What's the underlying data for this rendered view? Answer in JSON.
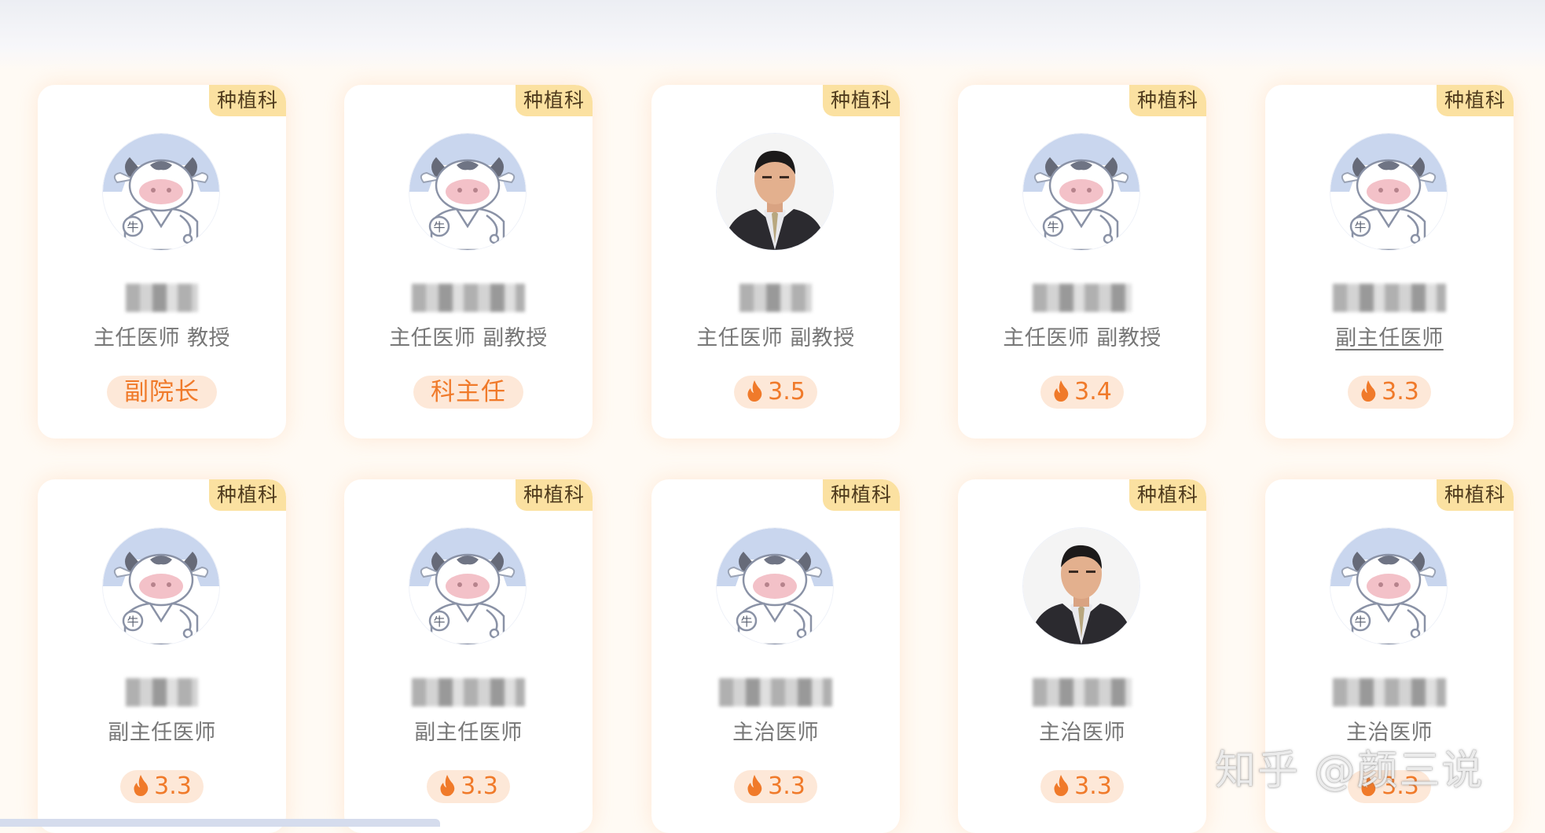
{
  "watermark": "知乎 @颜三说",
  "colors": {
    "accent": "#f07a2a",
    "badge_bg": "#fde8d8",
    "tag_bg": "#fbe1a1",
    "tag_text": "#4f3b1d",
    "title_text": "#777777"
  },
  "doctors": [
    {
      "dept": "种植科",
      "title": "主任医师 教授",
      "badge": "副院长",
      "badge_type": "role",
      "avatar": "cow-avatar-icon"
    },
    {
      "dept": "种植科",
      "title": "主任医师 副教授",
      "badge": "科主任",
      "badge_type": "role",
      "avatar": "cow-avatar-icon"
    },
    {
      "dept": "种植科",
      "title": "主任医师 副教授",
      "badge": "3.5",
      "badge_type": "score",
      "avatar": "doctor-photo"
    },
    {
      "dept": "种植科",
      "title": "主任医师 副教授",
      "badge": "3.4",
      "badge_type": "score",
      "avatar": "cow-avatar-icon"
    },
    {
      "dept": "种植科",
      "title": "副主任医师",
      "badge": "3.3",
      "badge_type": "score",
      "avatar": "cow-avatar-icon"
    },
    {
      "dept": "种植科",
      "title": "副主任医师",
      "badge": "3.3",
      "badge_type": "score",
      "avatar": "cow-avatar-icon"
    },
    {
      "dept": "种植科",
      "title": "副主任医师",
      "badge": "3.3",
      "badge_type": "score",
      "avatar": "cow-avatar-icon"
    },
    {
      "dept": "种植科",
      "title": "主治医师",
      "badge": "3.3",
      "badge_type": "score",
      "avatar": "cow-avatar-icon"
    },
    {
      "dept": "种植科",
      "title": "主治医师",
      "badge": "3.3",
      "badge_type": "score",
      "avatar": "doctor-photo"
    },
    {
      "dept": "种植科",
      "title": "主治医师",
      "badge": "3.3",
      "badge_type": "score",
      "avatar": "cow-avatar-icon"
    }
  ]
}
